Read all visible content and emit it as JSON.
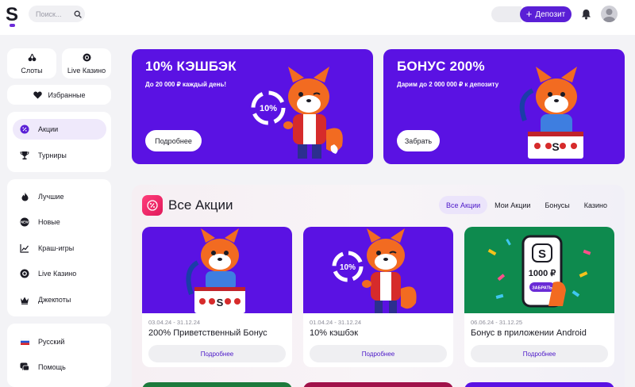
{
  "header": {
    "search_placeholder": "Поиск...",
    "deposit_label": "Депозит"
  },
  "sidebar": {
    "tiles": [
      {
        "label": "Слоты",
        "icon": "cherries-icon"
      },
      {
        "label": "Live Казино",
        "icon": "chip-icon"
      }
    ],
    "favorites_label": "Избранные",
    "group1": [
      {
        "label": "Акции",
        "icon": "promo-icon",
        "active": true
      },
      {
        "label": "Турниры",
        "icon": "trophy-icon"
      }
    ],
    "group2": [
      {
        "label": "Лучшие",
        "icon": "fire-icon"
      },
      {
        "label": "Новые",
        "icon": "new-badge-icon"
      },
      {
        "label": "Краш-игры",
        "icon": "chart-up-icon"
      },
      {
        "label": "Live Казино",
        "icon": "chip-icon"
      },
      {
        "label": "Джекпоты",
        "icon": "crown-icon"
      }
    ],
    "group3": [
      {
        "label": "Русский",
        "icon": "russia-flag-icon"
      },
      {
        "label": "Помощь",
        "icon": "chat-icon"
      }
    ]
  },
  "banners": [
    {
      "title": "10% КЭШБЭК",
      "subtitle": "До 20 000 ₽ каждый день!",
      "button": "Подробнее"
    },
    {
      "title": "БОНУС 200%",
      "subtitle": "Дарим до 2 000 000 ₽ к депозиту",
      "button": "Забрать"
    }
  ],
  "promotions": {
    "title": "Все Акции",
    "tabs": [
      {
        "label": "Все Акции",
        "active": true
      },
      {
        "label": "Мои Акции"
      },
      {
        "label": "Бонусы"
      },
      {
        "label": "Казино"
      }
    ],
    "cards": [
      {
        "dates": "03.04.24 - 31.12.24",
        "name": "200% Приветственный Бонус",
        "button": "Подробнее",
        "bg": "#5a12e3"
      },
      {
        "dates": "01.04.24 - 31.12.24",
        "name": "10% кэшбэк",
        "button": "Подробнее",
        "bg": "#5a12e3"
      },
      {
        "dates": "06.06.24 - 31.12.25",
        "name": "Бонус в приложении Android",
        "button": "Подробнее",
        "bg": "#0e8a4e"
      }
    ],
    "phone_amount": "1000 ₽",
    "phone_button": "ЗАБРАТЬ",
    "cashback_badge": "10%"
  },
  "colors": {
    "accent": "#5a1fd6",
    "banner": "#5a12e3",
    "android_card": "#0e8a4e"
  }
}
